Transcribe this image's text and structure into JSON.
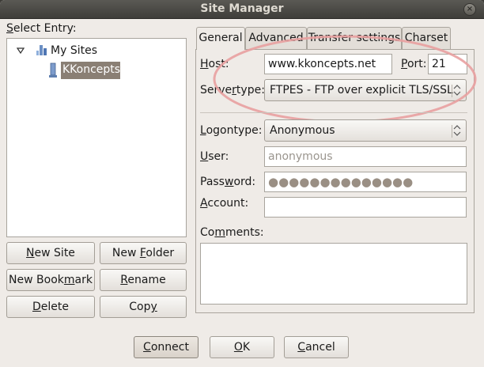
{
  "window": {
    "title": "Site Manager",
    "close_glyph": "×"
  },
  "left": {
    "select_entry_label": "Select Entry:",
    "tree": [
      {
        "label": "My Sites",
        "icon": "folder-icon",
        "expanded": true
      },
      {
        "label": "KKoncepts",
        "icon": "server-icon",
        "selected": true
      }
    ],
    "buttons": {
      "new_site": "New Site",
      "new_folder": "New Folder",
      "new_bookmark": "New Bookmark",
      "rename": "Rename",
      "delete": "Delete",
      "copy": "Copy"
    }
  },
  "tabs": [
    "General",
    "Advanced",
    "Transfer settings",
    "Charset"
  ],
  "general": {
    "host_label": "Host:",
    "host_value": "www.kkoncepts.net",
    "port_label": "Port:",
    "port_value": "21",
    "servertype_label": "Servertype:",
    "servertype_value": "FTPES - FTP over explicit TLS/SSL",
    "logontype_label": "Logontype:",
    "logontype_value": "Anonymous",
    "user_label": "User:",
    "user_value": "anonymous",
    "password_label": "Password:",
    "password_value": "●●●●●●●●●●●●●●",
    "account_label": "Account:",
    "account_value": "",
    "comments_label": "Comments:",
    "comments_value": ""
  },
  "footer": {
    "connect": "Connect",
    "ok": "OK",
    "cancel": "Cancel"
  },
  "colors": {
    "highlight": "#e8a0a0",
    "selection": "#8a7f74",
    "titlebar": "#4b4a45"
  }
}
